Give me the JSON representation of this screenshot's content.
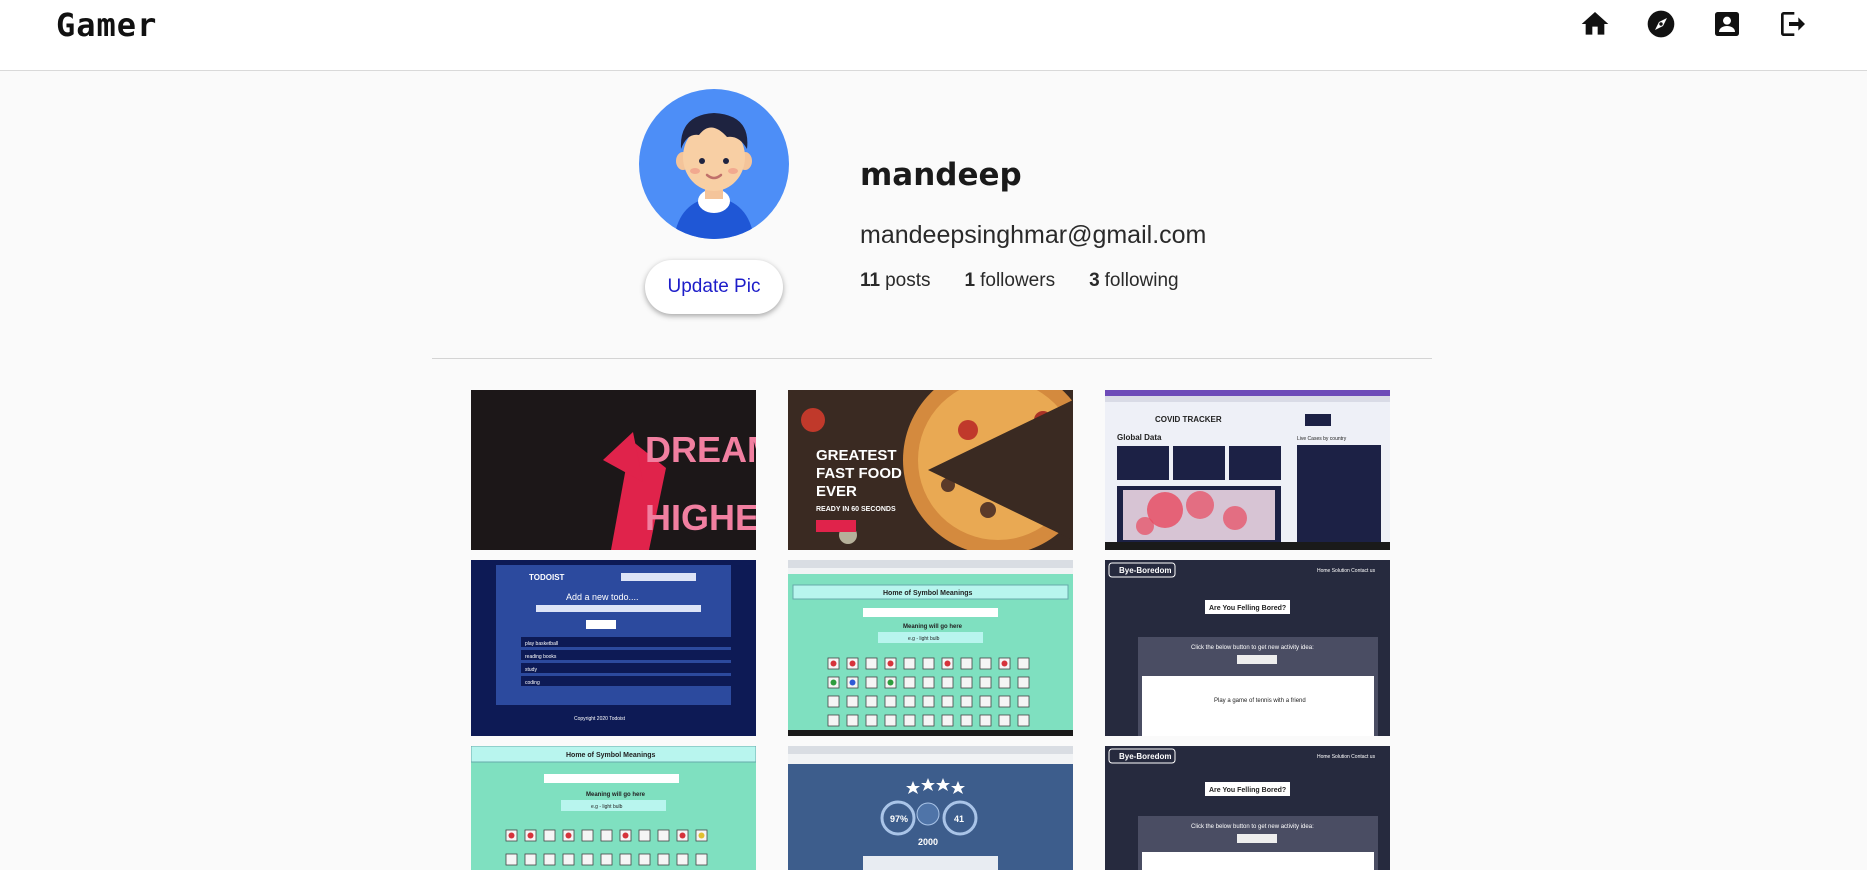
{
  "app": {
    "brand": "Gamer"
  },
  "nav": {
    "icons": [
      "home-icon",
      "explore-icon",
      "profile-icon",
      "logout-icon"
    ]
  },
  "profile": {
    "username": "mandeep",
    "email": "mandeepsinghmar@gmail.com",
    "update_pic_label": "Update Pic",
    "stats": {
      "posts_count": "11",
      "posts_label": "posts",
      "followers_count": "1",
      "followers_label": "followers",
      "following_count": "3",
      "following_label": "following"
    }
  },
  "posts": [
    {
      "lines": [
        "DREAM",
        "HIGHER"
      ]
    },
    {
      "lines": [
        "GREATEST",
        "FAST FOOD",
        "EVER",
        "READY IN 60 SECONDS"
      ]
    },
    {
      "lines": [
        "COVID TRACKER",
        "Global Data",
        "Live Cases by country"
      ]
    },
    {
      "lines": [
        "TODOIST",
        "Add a new todo....",
        "play basketball",
        "reading books",
        "study",
        "coding",
        "Copyright 2020 Todoist"
      ]
    },
    {
      "lines": [
        "Home of Symbol Meanings",
        "Meaning will go here",
        "e.g - light bulb"
      ]
    },
    {
      "lines": [
        "Bye-Boredom",
        "Are You Felling Bored?",
        "Click the below button to get new activity idea:",
        "Play a game of tennis with a friend"
      ]
    },
    {
      "lines": [
        "Home of Symbol Meanings",
        "Meaning will go here",
        "e.g - light bulb"
      ]
    },
    {
      "lines": [
        "97%",
        "41",
        "2000"
      ]
    },
    {
      "lines": [
        "Bye-Boredom",
        "Are You Felling Bored?",
        "Click the below button to get new activity idea:"
      ]
    }
  ]
}
